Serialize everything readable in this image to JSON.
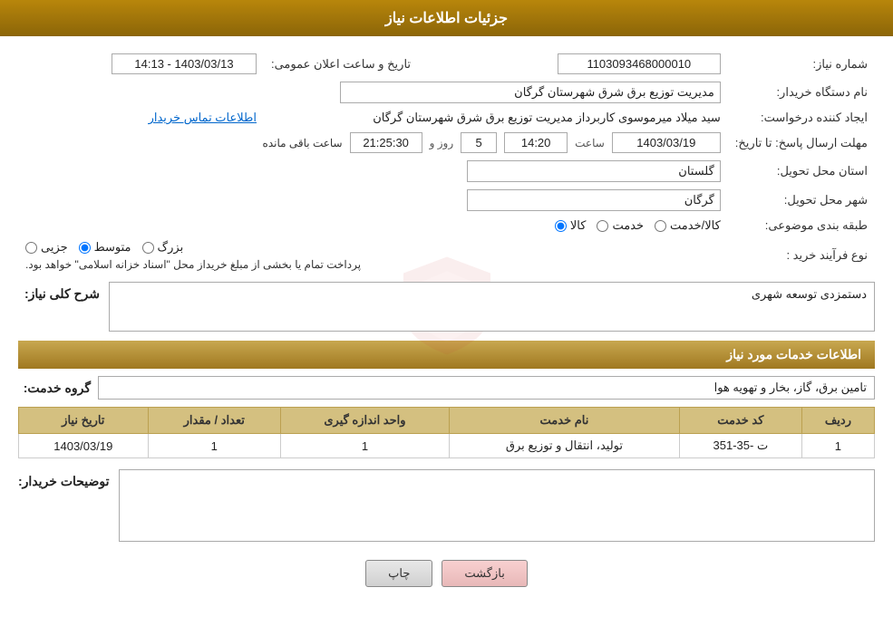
{
  "header": {
    "title": "جزئیات اطلاعات نیاز"
  },
  "fields": {
    "needNumber_label": "شماره نیاز:",
    "needNumber_value": "1103093468000010",
    "buyerOrg_label": "نام دستگاه خریدار:",
    "buyerOrg_value": "مدیریت توزیع برق شرق شهرستان گرگان",
    "creator_label": "ایجاد کننده درخواست:",
    "creator_value": "سید میلاد میرموسوی کاربرداز مدیریت توزیع برق شرق شهرستان گرگان",
    "creator_link": "اطلاعات تماس خریدار",
    "announceDate_label": "تاریخ و ساعت اعلان عمومی:",
    "announceDate_value": "1403/03/13 - 14:13",
    "replyDeadline_label": "مهلت ارسال پاسخ: تا تاریخ:",
    "replyDate_value": "1403/03/19",
    "replyTime_value": "14:20",
    "replyDays_label": "روز و",
    "replyDays_value": "5",
    "replyRemaining_value": "21:25:30",
    "replyRemaining_label": "ساعت باقی مانده",
    "province_label": "استان محل تحویل:",
    "province_value": "گلستان",
    "city_label": "شهر محل تحویل:",
    "city_value": "گرگان",
    "category_label": "طبقه بندی موضوعی:",
    "category_options": [
      "کالا",
      "خدمت",
      "کالا/خدمت"
    ],
    "category_selected": "کالا",
    "purchaseType_label": "نوع فرآیند خرید :",
    "purchaseType_options": [
      "جزیی",
      "متوسط",
      "بزرگ"
    ],
    "purchaseType_selected": "متوسط",
    "purchaseType_note": "پرداخت تمام یا بخشی از مبلغ خریداز محل \"اسناد خزانه اسلامی\" خواهد بود.",
    "description_label": "شرح کلی نیاز:",
    "description_value": "دستمزدی توسعه شهری",
    "services_section_title": "اطلاعات خدمات مورد نیاز",
    "serviceGroup_label": "گروه خدمت:",
    "serviceGroup_value": "تامین برق، گاز، بخار و تهویه هوا",
    "table": {
      "headers": [
        "ردیف",
        "کد خدمت",
        "نام خدمت",
        "واحد اندازه گیری",
        "تعداد / مقدار",
        "تاریخ نیاز"
      ],
      "rows": [
        {
          "row": "1",
          "code": "ت -35-351",
          "name": "تولید، انتقال و توزیع برق",
          "unit": "1",
          "qty": "1",
          "date": "1403/03/19"
        }
      ]
    },
    "buyerDesc_label": "توضیحات خریدار:",
    "buyerDesc_value": ""
  },
  "buttons": {
    "print_label": "چاپ",
    "back_label": "بازگشت"
  }
}
